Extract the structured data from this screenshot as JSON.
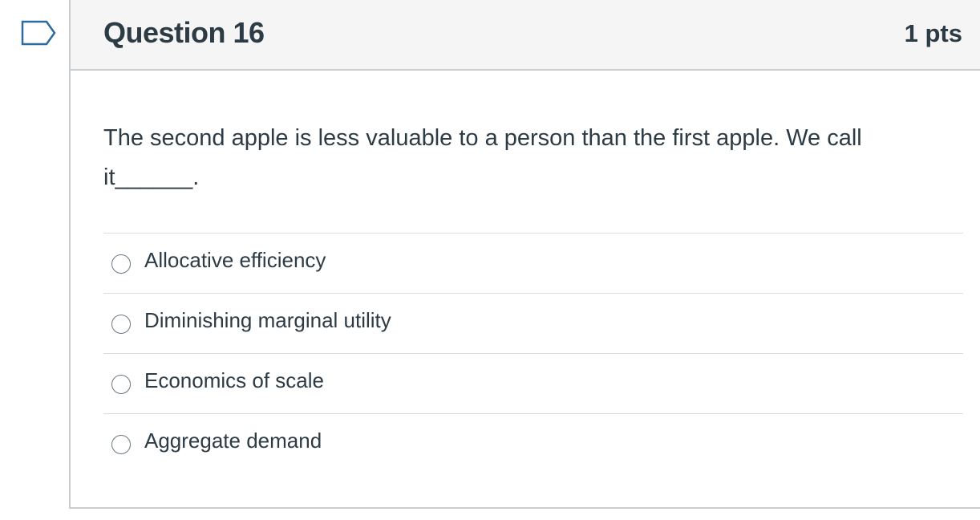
{
  "question": {
    "title": "Question 16",
    "points": "1 pts",
    "text": "The second apple is less valuable to a person than the first apple. We call it______.",
    "flag_icon": "flag-bookmark-icon",
    "answers": [
      {
        "label": "Allocative efficiency",
        "selected": false
      },
      {
        "label": "Diminishing marginal utility",
        "selected": false
      },
      {
        "label": "Economics of scale",
        "selected": false
      },
      {
        "label": "Aggregate demand",
        "selected": false
      }
    ]
  },
  "colors": {
    "text": "#2d3b45",
    "header_bg": "#f5f5f5",
    "border": "#c7cdd1",
    "flag": "#2d6b9e"
  }
}
